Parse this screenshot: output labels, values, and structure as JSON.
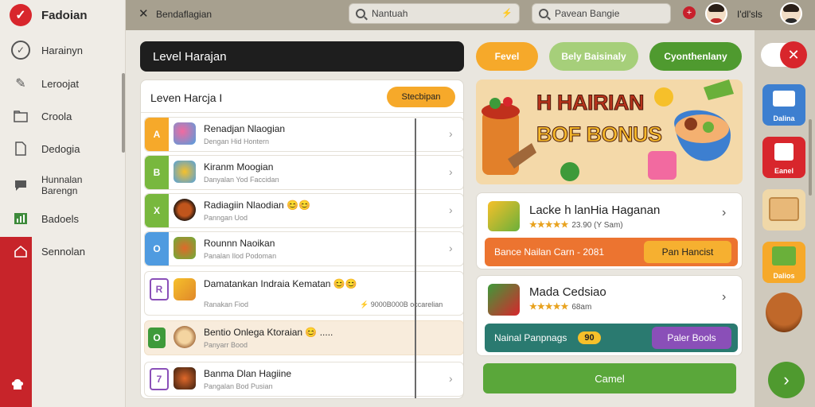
{
  "app": {
    "title": "Fadoian"
  },
  "sidebar": {
    "items": [
      {
        "label": "Harainyn",
        "icon": "check-circle-icon"
      },
      {
        "label": "Leroojat",
        "icon": "pencil-icon"
      },
      {
        "label": "Croola",
        "icon": "folder-icon"
      },
      {
        "label": "Dedogia",
        "icon": "document-icon"
      },
      {
        "label": "Hunnalan Barengn",
        "icon": "chat-icon"
      },
      {
        "label": "Badoels",
        "icon": "chart-icon"
      },
      {
        "label": "Sennolan",
        "icon": "home-icon"
      }
    ]
  },
  "topbar": {
    "breadcrumb": "Bendaflagian",
    "search1_value": "Nantuah",
    "search2_value": "Pavean Bangie",
    "user_name": "I'dl'sls"
  },
  "main": {
    "level_banner": "Level Harajan",
    "pills": [
      {
        "label": "Fevel",
        "color": "#f6a92a"
      },
      {
        "label": "Bely Baisinaly",
        "color": "#a6cf7a"
      },
      {
        "label": "Cyonthenlany",
        "color": "#4f9a2f"
      }
    ]
  },
  "list": {
    "header": "Leven Harcja I",
    "button": "Stecbipan",
    "rows": [
      {
        "num": "A",
        "color": "#f6a92a",
        "title": "Renadjan Nlaogian",
        "sub": "Dengan Hid Hontern",
        "extra": ""
      },
      {
        "num": "B",
        "color": "#78b83e",
        "title": "Kiranm Moogian",
        "sub": "Danyalan Yod Faccidan",
        "extra": ""
      },
      {
        "num": "X",
        "color": "#78b83e",
        "title": "Radiagiin Nlaodian 😊😊",
        "sub": "Panngan Uod",
        "extra": ""
      },
      {
        "num": "O",
        "color": "#4f9be0",
        "title": "Rounnn Naoikan",
        "sub": "Panalan Ilod Podoman",
        "extra": ""
      },
      {
        "num": "R",
        "color": "#8a4fb8",
        "title": "Damatankan Indraia Kematan 😊😊",
        "sub": "Ranakan Fiod",
        "extra": "⚡ 9000B000B occarelian"
      },
      {
        "num": "O",
        "color": "#ffffff",
        "title": "Bentio Onlega Ktoraian 😊 .....",
        "sub": "Panyarr Bood",
        "extra": ""
      },
      {
        "num": "7",
        "color": "#8a4fb8",
        "title": "Banma Dlan Hagiine",
        "sub": "Pangalan Bod Pusian",
        "extra": ""
      }
    ]
  },
  "promo": {
    "line1": "H HAIRIAN",
    "line2": "BOF BONUS"
  },
  "card1": {
    "title": "Lacke h lanHia Haganan",
    "stars": "★★★★★",
    "rating": "23.90 (Y Sam)",
    "bar_label": "Bance Nailan Carn - 2081",
    "bar_button": "Pan Hancist"
  },
  "card2": {
    "title": "Mada Cedsiao",
    "stars": "★★★★★",
    "rating": "68am",
    "bar_label": "Nainal Panpnags",
    "badge": "90",
    "bar_button": "Paler Bools"
  },
  "cancel_button": "Camel",
  "rail": {
    "tiles": [
      {
        "label": "Dalina",
        "color": "#3d7fd0"
      },
      {
        "label": "Eanel",
        "color": "#d8262c"
      },
      {
        "label": "",
        "color": "#f0d8a8"
      },
      {
        "label": "Dalios",
        "color": "#f6a92a"
      },
      {
        "label": "",
        "color": "#cfc9bc"
      }
    ]
  }
}
